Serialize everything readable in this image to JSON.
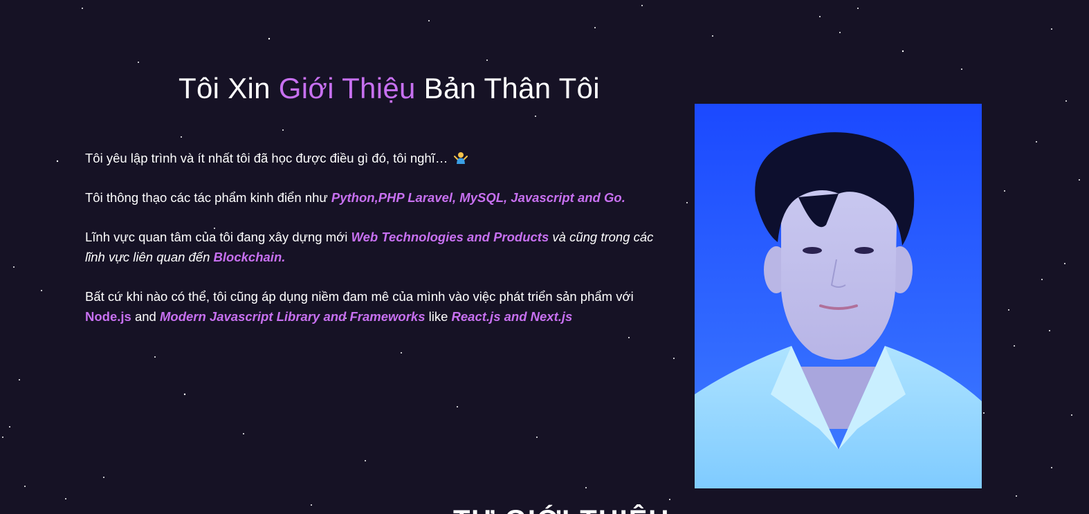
{
  "title": {
    "part1": "Tôi Xin ",
    "accent": "Giới Thiệu",
    "part2": " Bản Thân Tôi"
  },
  "about": {
    "p1": {
      "text": "Tôi yêu lập trình và ít nhất tôi đã học được điều gì đó, tôi nghĩ… ",
      "emoji_icon": "person-shrugging-icon"
    },
    "p2": {
      "text": "Tôi thông thạo các tác phẩm kinh điển như ",
      "highlight": "Python,PHP Laravel, MySQL, Javascript and Go."
    },
    "p3": {
      "text": "Lĩnh vực quan tâm của tôi đang xây dựng mới ",
      "highlight1": " Web Technologies and Products",
      "italic_text": " và cũng trong các lĩnh vực liên quan đến ",
      "highlight2": "Blockchain."
    },
    "p4": {
      "text": "Bất cứ khi nào có thể, tôi cũng áp dụng niềm đam mê của mình vào việc phát triển sản phẩm với ",
      "highlight1": "Node.js",
      "and": " and ",
      "highlight2": "Modern Javascript Library and Frameworks ",
      "like": " like ",
      "highlight3": "React.js and Next.js"
    }
  },
  "photo": {
    "alt": "avatar"
  },
  "bottom_heading": "TỰ GIỚI THIỆU",
  "colors": {
    "background": "#161225",
    "accent": "#c770f0",
    "photo_bg": "#1d4dff"
  }
}
